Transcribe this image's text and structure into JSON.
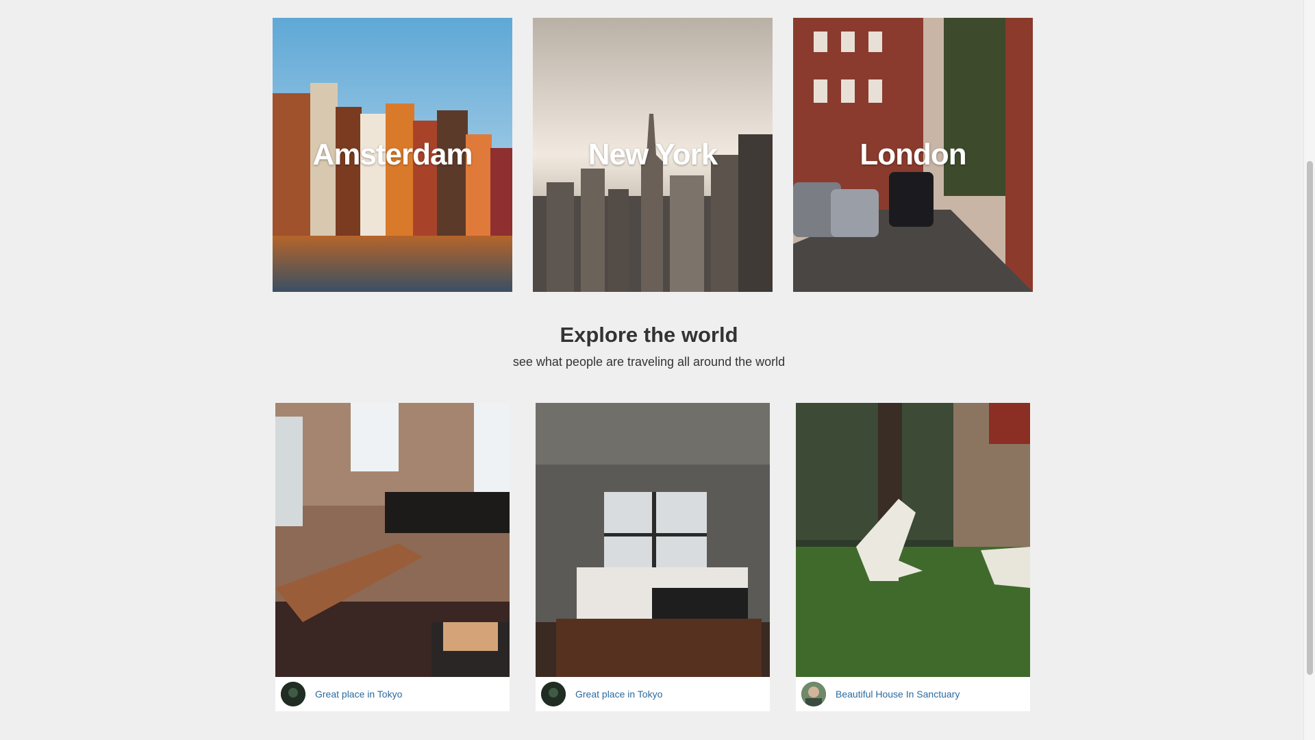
{
  "cities": [
    {
      "name": "Amsterdam"
    },
    {
      "name": "New York"
    },
    {
      "name": "London"
    }
  ],
  "explore": {
    "title": "Explore the world",
    "subtitle": "see what people are traveling all around the world"
  },
  "listings": [
    {
      "title": "Great place in Tokyo",
      "avatar_icon": "user-avatar-icon"
    },
    {
      "title": "Great place in Tokyo",
      "avatar_icon": "user-avatar-icon"
    },
    {
      "title": "Beautiful House In Sanctuary",
      "avatar_icon": "user-avatar-icon"
    }
  ],
  "colors": {
    "link": "#2b6a9e",
    "heading": "#333333",
    "page_background": "#efefef"
  }
}
